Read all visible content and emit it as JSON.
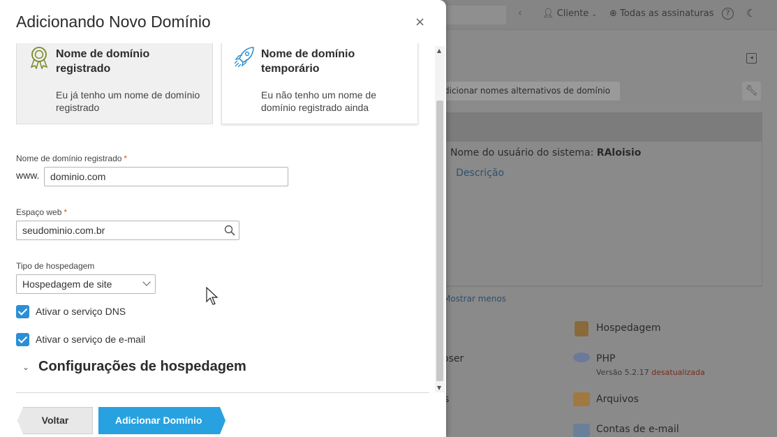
{
  "background": {
    "top": {
      "cliente": "Cliente",
      "assinaturas": "Todas as assinaturas"
    },
    "alt_names_button": "dicionar nomes alternativos de domínio",
    "user_label": "Nome do usuário do sistema:",
    "user_value": "RAloisio",
    "link_partial": "ão",
    "link_desc": "Descrição",
    "mostrar_menos": "Mostrar menos",
    "services": {
      "hospedagem": "Hospedagem",
      "php": "PHP",
      "php_version": "Versão 5.2.17",
      "php_status": "desatualizada",
      "composer_partial": "oser",
      "arquivos": "Arquivos",
      "s_partial": "s",
      "email": "Contas de e-mail"
    },
    "colors": {
      "link": "#2f4f6d",
      "warning": "#7a2a1a"
    }
  },
  "modal": {
    "title": "Adicionando Novo Domínio",
    "close_label": "×",
    "options": {
      "registered": {
        "title": "Nome de domínio registrado",
        "description": "Eu já tenho um nome de domínio registrado",
        "icon": "award-icon"
      },
      "temporary": {
        "title": "Nome de domínio temporário",
        "description": "Eu não tenho um nome de domínio registrado ainda",
        "icon": "rocket-icon"
      }
    },
    "fields": {
      "domain": {
        "label": "Nome de domínio registrado",
        "prefix": "www.",
        "value": "dominio.com"
      },
      "webspace": {
        "label": "Espaço web",
        "value": "seudominio.com.br"
      },
      "hosting_type": {
        "label": "Tipo de hospedagem",
        "value": "Hospedagem de site"
      }
    },
    "checks": {
      "dns": {
        "label": "Ativar o serviço DNS",
        "checked": true
      },
      "email": {
        "label": "Ativar o serviço de e-mail",
        "checked": true
      }
    },
    "section": {
      "title": "Configurações de hospedagem"
    },
    "buttons": {
      "back": "Voltar",
      "add": "Adicionar Domínio"
    },
    "colors": {
      "primary": "#28a1e0",
      "checkbox": "#2b8fd6",
      "required": "#d4572a"
    }
  }
}
